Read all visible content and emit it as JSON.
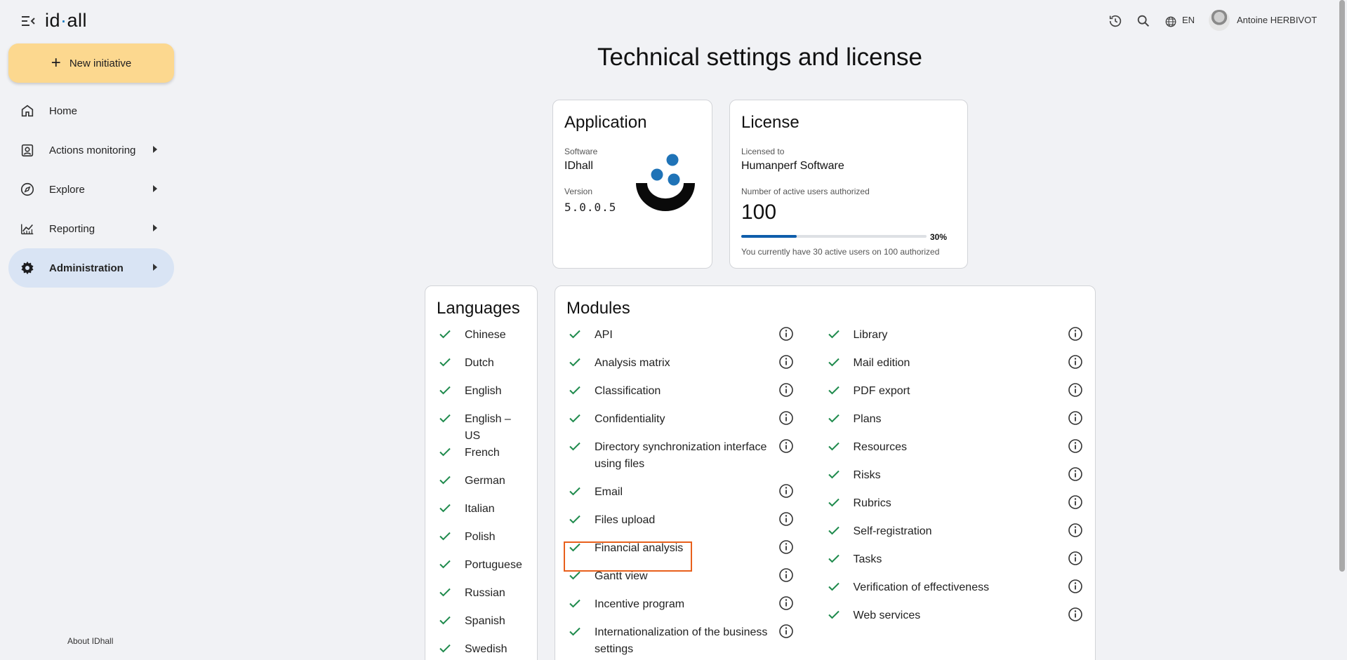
{
  "app": {
    "logo_text_start": "id",
    "logo_text_mid": "h",
    "logo_text_end": "all",
    "new_button_label": "New initiative",
    "about_label": "About IDhall"
  },
  "nav": {
    "items": [
      {
        "label": "Home",
        "icon": "home-icon",
        "has_caret": false
      },
      {
        "label": "Actions monitoring",
        "icon": "clipboard-user-icon",
        "has_caret": true
      },
      {
        "label": "Explore",
        "icon": "compass-icon",
        "has_caret": true
      },
      {
        "label": "Reporting",
        "icon": "chart-line-icon",
        "has_caret": true
      },
      {
        "label": "Administration",
        "icon": "gear-icon",
        "has_caret": true,
        "active": true
      }
    ]
  },
  "header": {
    "language": "EN",
    "user_name": "Antoine HERBIVOT"
  },
  "page": {
    "title": "Technical settings and license"
  },
  "application": {
    "title": "Application",
    "software_label": "Software",
    "software_value": "IDhall",
    "version_label": "Version",
    "version_value": "5.0.0.5"
  },
  "license": {
    "title": "License",
    "licensed_to_label": "Licensed to",
    "licensed_to_value": "Humanperf Software",
    "users_label": "Number of active users authorized",
    "users_value": "100",
    "usage_percent": 30,
    "usage_percent_label": "30%",
    "usage_note": "You currently have 30 active users on 100 authorized"
  },
  "languages": {
    "title": "Languages",
    "items": [
      "Chinese",
      "Dutch",
      "English",
      "English – US",
      "French",
      "German",
      "Italian",
      "Polish",
      "Portuguese",
      "Russian",
      "Spanish",
      "Swedish"
    ]
  },
  "modules": {
    "title": "Modules",
    "left": [
      "API",
      "Analysis matrix",
      "Classification",
      "Confidentiality",
      "Directory synchronization interface using files",
      "Email",
      "Files upload",
      "Financial analysis",
      "Gantt view",
      "Incentive program",
      "Internationalization of the business settings"
    ],
    "right": [
      "Library",
      "Mail edition",
      "PDF export",
      "Plans",
      "Resources",
      "Risks",
      "Rubrics",
      "Self-registration",
      "Tasks",
      "Verification of effectiveness",
      "Web services"
    ]
  },
  "colors": {
    "accent": "#0f5eab",
    "new_button_bg": "#fcd88f",
    "active_nav_bg": "#d9e4f4",
    "check_green": "#1e8a4c",
    "highlight_border": "#e8601c"
  }
}
